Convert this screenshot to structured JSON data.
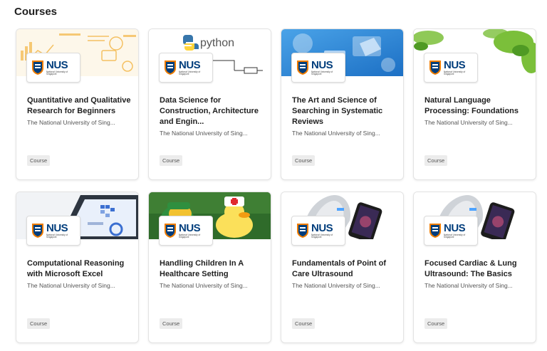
{
  "page": {
    "title": "Courses"
  },
  "logo": {
    "word": "NUS",
    "sub": "National University of Singapore"
  },
  "cards": [
    {
      "title": "Quantitative and Qualitative Research for Beginners",
      "org": "The National University of Sing...",
      "badge": "Course"
    },
    {
      "title": "Data Science for Construction, Architecture and Engin...",
      "org": "The National University of Sing...",
      "badge": "Course",
      "banner_text": "python"
    },
    {
      "title": "The Art and Science of Searching in Systematic Reviews",
      "org": "The National University of Sing...",
      "badge": "Course"
    },
    {
      "title": "Natural Language Processing: Foundations",
      "org": "The National University of Sing...",
      "badge": "Course"
    },
    {
      "title": "Computational Reasoning with Microsoft Excel",
      "org": "The National University of Sing...",
      "badge": "Course"
    },
    {
      "title": "Handling Children In A Healthcare Setting",
      "org": "The National University of Sing...",
      "badge": "Course"
    },
    {
      "title": "Fundamentals of Point of Care Ultrasound",
      "org": "The National University of Sing...",
      "badge": "Course"
    },
    {
      "title": "Focused Cardiac & Lung Ultrasound: The Basics",
      "org": "The National University of Sing...",
      "badge": "Course"
    }
  ],
  "colors": {
    "nus_blue": "#003d7c",
    "nus_orange": "#ef7c00",
    "badge_bg": "#ececec"
  }
}
